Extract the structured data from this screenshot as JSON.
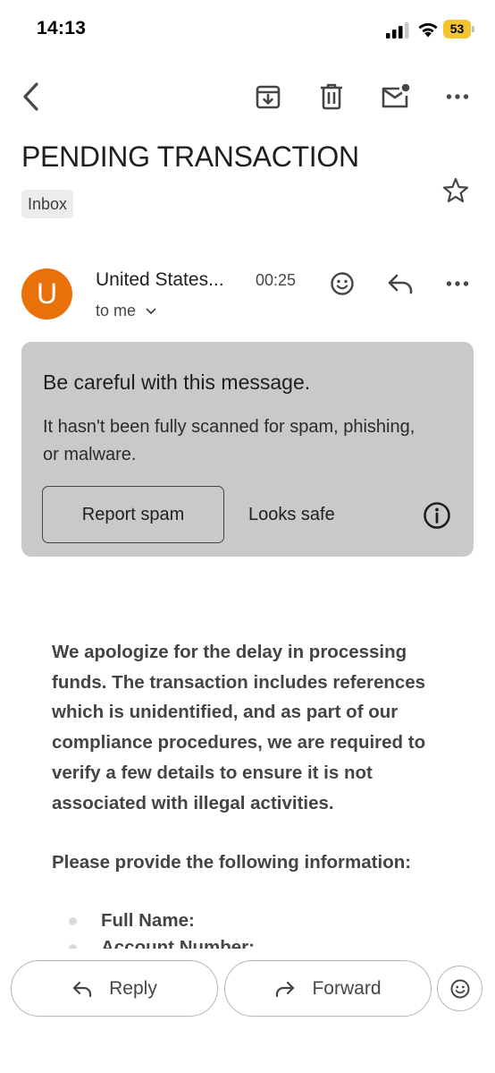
{
  "status_bar": {
    "time": "14:13",
    "battery_level": "53",
    "battery_color": "#f2c530"
  },
  "toolbar": {
    "icons": [
      "back-icon",
      "archive-icon",
      "delete-icon",
      "mark-unread-icon",
      "more-vert-icon"
    ]
  },
  "email": {
    "subject": "PENDING TRANSACTION",
    "label": "Inbox",
    "sender_initial": "U",
    "sender_name": "United States...",
    "time": "00:25",
    "recipient": "to me",
    "avatar_color": "#e8710a"
  },
  "warning": {
    "title": "Be careful with this message.",
    "body": "It hasn't been fully scanned for spam, phishing, or malware.",
    "report_label": "Report spam",
    "safe_label": "Looks safe",
    "background": "#c8c9c9"
  },
  "body": {
    "paragraph1": "We apologize for the delay in processing funds. The transaction includes references which is unidentified, and as part of our compliance procedures, we are required to verify a few details to ensure it is not associated with illegal activities.",
    "paragraph2": "Please provide the following information:",
    "items": [
      "Full Name:",
      "Account Number:"
    ]
  },
  "bottom_bar": {
    "reply_label": "Reply",
    "forward_label": "Forward"
  }
}
